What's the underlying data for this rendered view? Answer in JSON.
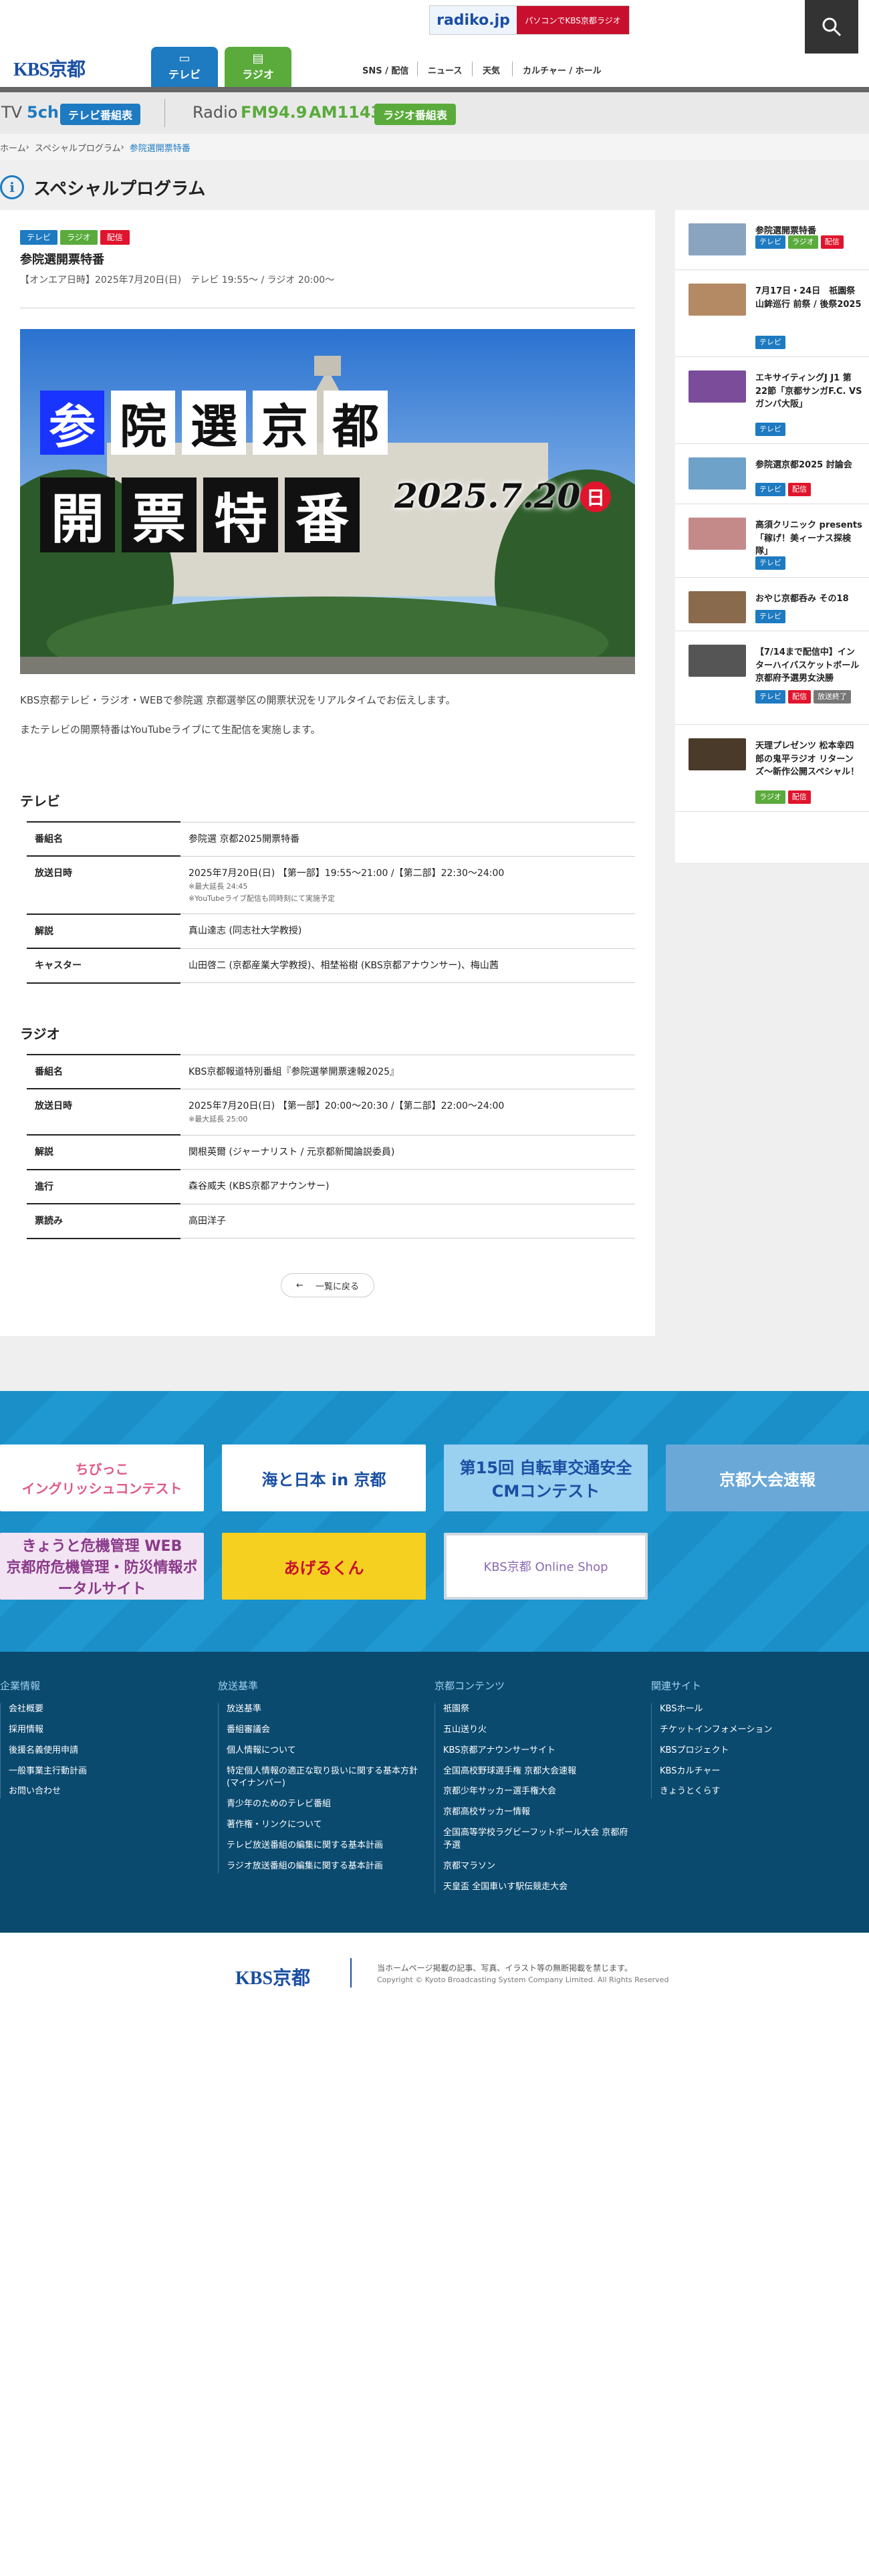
{
  "header": {
    "radiko_logo": "radiko.jp",
    "radiko_text": "パソコンでKBS京都ラジオ",
    "brand": "KBS京都",
    "tabs": [
      {
        "label": "テレビ",
        "icon": "tv-icon"
      },
      {
        "label": "ラジオ",
        "icon": "radio-icon"
      }
    ],
    "nav": [
      "SNS / 配信",
      "ニュース",
      "天気",
      "カルチャー / ホール"
    ]
  },
  "channel_bar": {
    "tv_label": "TV",
    "tv_ch": "5ch",
    "tv_button": "テレビ番組表",
    "radio_label": "Radio",
    "fm": "FM94.9",
    "am": "AM1143",
    "radio_button": "ラジオ番組表"
  },
  "breadcrumb": [
    "ホーム",
    "スペシャルプログラム",
    "参院選開票特番"
  ],
  "page_title": "スペシャルプログラム",
  "article": {
    "tags": [
      "テレビ",
      "ラジオ",
      "配信"
    ],
    "title": "参院選開票特番",
    "airdate": "【オンエア日時】2025年7月20日(日)　テレビ 19:55〜 / ラジオ 20:00〜",
    "hero": {
      "line1": [
        "参",
        "院",
        "選",
        "京",
        "都"
      ],
      "line2": [
        "開",
        "票",
        "特",
        "番"
      ],
      "date": "2025.7.20",
      "weekday": "日"
    },
    "intro1": "KBS京都テレビ・ラジオ・WEBで参院選 京都選挙区の開票状況をリアルタイムでお伝えします。",
    "intro2": "またテレビの開票特番はYouTubeライブにて生配信を実施します。",
    "tv_heading": "テレビ",
    "tv_rows": [
      {
        "k": "番組名",
        "v": "参院選 京都2025開票特番",
        "notes": []
      },
      {
        "k": "放送日時",
        "v": "2025年7月20日(日) 【第一部】19:55〜21:00 /【第二部】22:30〜24:00",
        "notes": [
          "※最大延長 24:45",
          "※YouTubeライブ配信も同時刻にて実施予定"
        ]
      },
      {
        "k": "解説",
        "v": "真山達志 (同志社大学教授)",
        "notes": []
      },
      {
        "k": "キャスター",
        "v": "山田啓二 (京都産業大学教授)、相埜裕樹 (KBS京都アナウンサー)、梅山茜",
        "notes": []
      }
    ],
    "radio_heading": "ラジオ",
    "radio_rows": [
      {
        "k": "番組名",
        "v": "KBS京都報道特別番組『参院選挙開票速報2025』",
        "notes": []
      },
      {
        "k": "放送日時",
        "v": "2025年7月20日(日) 【第一部】20:00〜20:30 /【第二部】22:00〜24:00",
        "notes": [
          "※最大延長 25:00"
        ]
      },
      {
        "k": "解説",
        "v": "関根英爾 (ジャーナリスト / 元京都新聞論説委員)",
        "notes": []
      },
      {
        "k": "進行",
        "v": "森谷威夫 (KBS京都アナウンサー)",
        "notes": []
      },
      {
        "k": "票読み",
        "v": "高田洋子",
        "notes": []
      }
    ],
    "back_label": "一覧に戻る"
  },
  "sidebar": [
    {
      "title": "参院選開票特番",
      "tags": [
        "テレビ",
        "ラジオ",
        "配信"
      ],
      "color": "#8aa4c0"
    },
    {
      "title": "7月17日・24日　祇園祭 山鉾巡行 前祭 / 後祭2025",
      "tags": [
        "テレビ"
      ],
      "color": "#b48a64"
    },
    {
      "title": "エキサイティングJ J1 第22節「京都サンガF.C. VS ガンバ大阪」",
      "tags": [
        "テレビ"
      ],
      "color": "#7a4c9a"
    },
    {
      "title": "参院選京都2025 討論会",
      "tags": [
        "テレビ",
        "配信"
      ],
      "color": "#6fa2c8"
    },
    {
      "title": "高須クリニック presents「稼げ！美ィーナス探検隊」",
      "tags": [
        "テレビ"
      ],
      "color": "#c48a8a"
    },
    {
      "title": "おやじ京都呑み その18",
      "tags": [
        "テレビ"
      ],
      "color": "#8a6a4c"
    },
    {
      "title": "【7/14まで配信中】インターハイバスケットボール京都府予選男女決勝",
      "tags": [
        "テレビ",
        "配信",
        "放送終了"
      ],
      "color": "#555"
    },
    {
      "title": "天理プレゼンツ 松本幸四郎の鬼平ラジオ リターンズ〜新作公開スペシャル！",
      "tags": [
        "ラジオ",
        "配信"
      ],
      "color": "#4a3a2a"
    }
  ],
  "banners": [
    {
      "text": "ちびっこ\nイングリッシュコンテスト",
      "bg": "#ffffff",
      "fg": "#e05a8a"
    },
    {
      "text": "海と日本 in 京都",
      "bg": "#ffffff",
      "fg": "#1a4fa3"
    },
    {
      "text": "第15回 自転車交通安全 CMコンテスト",
      "bg": "#9ad0f0",
      "fg": "#1a4fa3"
    },
    {
      "text": "京都大会速報",
      "bg": "#6aa8d8",
      "fg": "#ffffff"
    },
    {
      "text": "きょうと危機管理 WEB\n京都府危機管理・防災情報ポータルサイト",
      "bg": "#f3e4f3",
      "fg": "#8a3a8a"
    },
    {
      "text": "あげるくん",
      "bg": "#f5d020",
      "fg": "#c8102e"
    },
    {
      "text": "KBS京都 Online Shop",
      "bg": "#ffffff",
      "fg": "#8a6ab0"
    }
  ],
  "footer": {
    "columns": [
      {
        "h": "企業情報",
        "items": [
          "会社概要",
          "採用情報",
          "後援名義使用申請",
          "一般事業主行動計画",
          "お問い合わせ"
        ]
      },
      {
        "h": "放送基準",
        "items": [
          "放送基準",
          "番組審議会",
          "個人情報について",
          "特定個人情報の適正な取り扱いに関する基本方針(マイナンバー)",
          "青少年のためのテレビ番組",
          "著作権・リンクについて",
          "テレビ放送番組の編集に関する基本計画",
          "ラジオ放送番組の編集に関する基本計画"
        ]
      },
      {
        "h": "京都コンテンツ",
        "items": [
          "祇園祭",
          "五山送り火",
          "KBS京都アナウンサーサイト",
          "全国高校野球選手権 京都大会速報",
          "京都少年サッカー選手権大会",
          "京都高校サッカー情報",
          "全国高等学校ラグビーフットボール大会 京都府予選",
          "京都マラソン",
          "天皇盃 全国車いす駅伝競走大会"
        ]
      },
      {
        "h": "関連サイト",
        "items": [
          "KBSホール",
          "チケットインフォメーション",
          "KBSプロジェクト",
          "KBSカルチャー",
          "きょうとくらす"
        ]
      }
    ],
    "logo": "KBS京都",
    "note1": "当ホームページ掲載の記事、写真、イラスト等の無断掲載を禁じます。",
    "note2": "Copyright © Kyoto Broadcasting System Company Limited. All Rights Reserved"
  }
}
